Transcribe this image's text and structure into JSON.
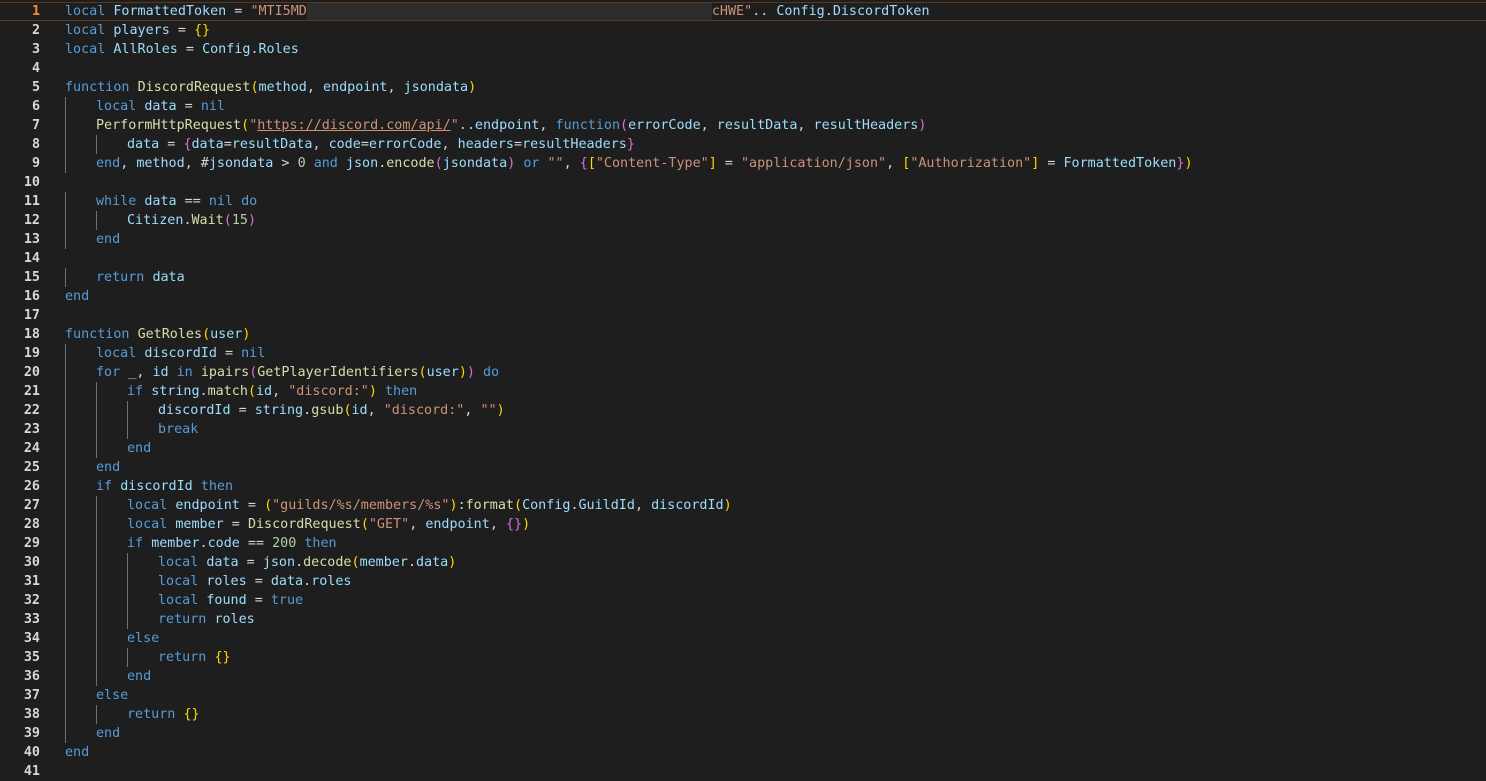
{
  "editor": {
    "active_line": 1,
    "lines": [
      {
        "n": "1",
        "indent": 0,
        "tokens": [
          [
            "kw",
            "local"
          ],
          [
            "op",
            " "
          ],
          [
            "var",
            "FormattedToken"
          ],
          [
            "op",
            " = "
          ],
          [
            "str",
            "\"MTI5MD"
          ],
          [
            "redact",
            "xxxxxxxxxxxxxxxxxxxxxxxxxxxxxxxxxxxxxxxxxxxxxxxxxxxxxxxxxxxx"
          ],
          [
            "str",
            "cHWE\""
          ],
          [
            "op",
            ".. "
          ],
          [
            "var",
            "Config"
          ],
          [
            "op",
            "."
          ],
          [
            "var",
            "DiscordToken"
          ]
        ]
      },
      {
        "n": "2",
        "indent": 0,
        "tokens": [
          [
            "kw",
            "local"
          ],
          [
            "op",
            " "
          ],
          [
            "var",
            "players"
          ],
          [
            "op",
            " = "
          ],
          [
            "brk",
            "{}"
          ]
        ]
      },
      {
        "n": "3",
        "indent": 0,
        "tokens": [
          [
            "kw",
            "local"
          ],
          [
            "op",
            " "
          ],
          [
            "var",
            "AllRoles"
          ],
          [
            "op",
            " = "
          ],
          [
            "var",
            "Config"
          ],
          [
            "op",
            "."
          ],
          [
            "var",
            "Roles"
          ]
        ]
      },
      {
        "n": "4",
        "indent": 0,
        "tokens": []
      },
      {
        "n": "5",
        "indent": 0,
        "tokens": [
          [
            "kw",
            "function"
          ],
          [
            "op",
            " "
          ],
          [
            "fn",
            "DiscordRequest"
          ],
          [
            "brk",
            "("
          ],
          [
            "var",
            "method"
          ],
          [
            "op",
            ", "
          ],
          [
            "var",
            "endpoint"
          ],
          [
            "op",
            ", "
          ],
          [
            "var",
            "jsondata"
          ],
          [
            "brk",
            ")"
          ]
        ]
      },
      {
        "n": "6",
        "indent": 1,
        "tokens": [
          [
            "kw",
            "local"
          ],
          [
            "op",
            " "
          ],
          [
            "var",
            "data"
          ],
          [
            "op",
            " = "
          ],
          [
            "kw",
            "nil"
          ]
        ]
      },
      {
        "n": "7",
        "indent": 1,
        "tokens": [
          [
            "fn",
            "PerformHttpRequest"
          ],
          [
            "brk",
            "("
          ],
          [
            "str",
            "\""
          ],
          [
            "url",
            "https://discord.com/api/"
          ],
          [
            "str",
            "\""
          ],
          [
            "op",
            ".."
          ],
          [
            "var",
            "endpoint"
          ],
          [
            "op",
            ", "
          ],
          [
            "kw",
            "function"
          ],
          [
            "brk2",
            "("
          ],
          [
            "var",
            "errorCode"
          ],
          [
            "op",
            ", "
          ],
          [
            "var",
            "resultData"
          ],
          [
            "op",
            ", "
          ],
          [
            "var",
            "resultHeaders"
          ],
          [
            "brk2",
            ")"
          ]
        ]
      },
      {
        "n": "8",
        "indent": 2,
        "tokens": [
          [
            "var",
            "data"
          ],
          [
            "op",
            " = "
          ],
          [
            "brk2",
            "{"
          ],
          [
            "var",
            "data"
          ],
          [
            "op",
            "="
          ],
          [
            "var",
            "resultData"
          ],
          [
            "op",
            ", "
          ],
          [
            "var",
            "code"
          ],
          [
            "op",
            "="
          ],
          [
            "var",
            "errorCode"
          ],
          [
            "op",
            ", "
          ],
          [
            "var",
            "headers"
          ],
          [
            "op",
            "="
          ],
          [
            "var",
            "resultHeaders"
          ],
          [
            "brk2",
            "}"
          ]
        ]
      },
      {
        "n": "9",
        "indent": 1,
        "tokens": [
          [
            "kw",
            "end"
          ],
          [
            "op",
            ", "
          ],
          [
            "var",
            "method"
          ],
          [
            "op",
            ", #"
          ],
          [
            "var",
            "jsondata"
          ],
          [
            "op",
            " > "
          ],
          [
            "num",
            "0"
          ],
          [
            "op",
            " "
          ],
          [
            "kw",
            "and"
          ],
          [
            "op",
            " "
          ],
          [
            "var",
            "json"
          ],
          [
            "op",
            "."
          ],
          [
            "fn",
            "encode"
          ],
          [
            "brk2",
            "("
          ],
          [
            "var",
            "jsondata"
          ],
          [
            "brk2",
            ")"
          ],
          [
            "op",
            " "
          ],
          [
            "kw",
            "or"
          ],
          [
            "op",
            " "
          ],
          [
            "str",
            "\"\""
          ],
          [
            "op",
            ", "
          ],
          [
            "brk2",
            "{"
          ],
          [
            "brk",
            "["
          ],
          [
            "str",
            "\"Content-Type\""
          ],
          [
            "brk",
            "]"
          ],
          [
            "op",
            " = "
          ],
          [
            "str",
            "\"application/json\""
          ],
          [
            "op",
            ", "
          ],
          [
            "brk",
            "["
          ],
          [
            "str",
            "\"Authorization\""
          ],
          [
            "brk",
            "]"
          ],
          [
            "op",
            " = "
          ],
          [
            "var",
            "FormattedToken"
          ],
          [
            "brk2",
            "}"
          ],
          [
            "brk",
            ")"
          ]
        ]
      },
      {
        "n": "10",
        "indent": 0,
        "tokens": []
      },
      {
        "n": "11",
        "indent": 1,
        "tokens": [
          [
            "kw",
            "while"
          ],
          [
            "op",
            " "
          ],
          [
            "var",
            "data"
          ],
          [
            "op",
            " == "
          ],
          [
            "kw",
            "nil"
          ],
          [
            "op",
            " "
          ],
          [
            "kw",
            "do"
          ]
        ]
      },
      {
        "n": "12",
        "indent": 2,
        "tokens": [
          [
            "var",
            "Citizen"
          ],
          [
            "op",
            "."
          ],
          [
            "fn",
            "Wait"
          ],
          [
            "brk2",
            "("
          ],
          [
            "num",
            "15"
          ],
          [
            "brk2",
            ")"
          ]
        ]
      },
      {
        "n": "13",
        "indent": 1,
        "tokens": [
          [
            "kw",
            "end"
          ]
        ]
      },
      {
        "n": "14",
        "indent": 0,
        "tokens": []
      },
      {
        "n": "15",
        "indent": 1,
        "tokens": [
          [
            "kw",
            "return"
          ],
          [
            "op",
            " "
          ],
          [
            "var",
            "data"
          ]
        ]
      },
      {
        "n": "16",
        "indent": 0,
        "tokens": [
          [
            "kw",
            "end"
          ]
        ]
      },
      {
        "n": "17",
        "indent": 0,
        "tokens": []
      },
      {
        "n": "18",
        "indent": 0,
        "tokens": [
          [
            "kw",
            "function"
          ],
          [
            "op",
            " "
          ],
          [
            "fn",
            "GetRoles"
          ],
          [
            "brk",
            "("
          ],
          [
            "var",
            "user"
          ],
          [
            "brk",
            ")"
          ]
        ]
      },
      {
        "n": "19",
        "indent": 1,
        "tokens": [
          [
            "kw",
            "local"
          ],
          [
            "op",
            " "
          ],
          [
            "var",
            "discordId"
          ],
          [
            "op",
            " = "
          ],
          [
            "kw",
            "nil"
          ]
        ]
      },
      {
        "n": "20",
        "indent": 1,
        "tokens": [
          [
            "kw",
            "for"
          ],
          [
            "op",
            " "
          ],
          [
            "var",
            "_"
          ],
          [
            "op",
            ", "
          ],
          [
            "var",
            "id"
          ],
          [
            "op",
            " "
          ],
          [
            "kw",
            "in"
          ],
          [
            "op",
            " "
          ],
          [
            "fn",
            "ipairs"
          ],
          [
            "brk2",
            "("
          ],
          [
            "fn",
            "GetPlayerIdentifiers"
          ],
          [
            "brk",
            "("
          ],
          [
            "var",
            "user"
          ],
          [
            "brk",
            ")"
          ],
          [
            "brk2",
            ")"
          ],
          [
            "op",
            " "
          ],
          [
            "kw",
            "do"
          ]
        ]
      },
      {
        "n": "21",
        "indent": 2,
        "tokens": [
          [
            "kw",
            "if"
          ],
          [
            "op",
            " "
          ],
          [
            "var",
            "string"
          ],
          [
            "op",
            "."
          ],
          [
            "fn",
            "match"
          ],
          [
            "brk",
            "("
          ],
          [
            "var",
            "id"
          ],
          [
            "op",
            ", "
          ],
          [
            "str",
            "\"discord:\""
          ],
          [
            "brk",
            ")"
          ],
          [
            "op",
            " "
          ],
          [
            "kw",
            "then"
          ]
        ]
      },
      {
        "n": "22",
        "indent": 3,
        "tokens": [
          [
            "var",
            "discordId"
          ],
          [
            "op",
            " = "
          ],
          [
            "var",
            "string"
          ],
          [
            "op",
            "."
          ],
          [
            "fn",
            "gsub"
          ],
          [
            "brk",
            "("
          ],
          [
            "var",
            "id"
          ],
          [
            "op",
            ", "
          ],
          [
            "str",
            "\"discord:\""
          ],
          [
            "op",
            ", "
          ],
          [
            "str",
            "\"\""
          ],
          [
            "brk",
            ")"
          ]
        ]
      },
      {
        "n": "23",
        "indent": 3,
        "tokens": [
          [
            "kw",
            "break"
          ]
        ]
      },
      {
        "n": "24",
        "indent": 2,
        "tokens": [
          [
            "kw",
            "end"
          ]
        ]
      },
      {
        "n": "25",
        "indent": 1,
        "tokens": [
          [
            "kw",
            "end"
          ]
        ]
      },
      {
        "n": "26",
        "indent": 1,
        "tokens": [
          [
            "kw",
            "if"
          ],
          [
            "op",
            " "
          ],
          [
            "var",
            "discordId"
          ],
          [
            "op",
            " "
          ],
          [
            "kw",
            "then"
          ]
        ]
      },
      {
        "n": "27",
        "indent": 2,
        "tokens": [
          [
            "kw",
            "local"
          ],
          [
            "op",
            " "
          ],
          [
            "var",
            "endpoint"
          ],
          [
            "op",
            " = "
          ],
          [
            "brk",
            "("
          ],
          [
            "str",
            "\"guilds/%s/members/%s\""
          ],
          [
            "brk",
            ")"
          ],
          [
            "op",
            ":"
          ],
          [
            "fn",
            "format"
          ],
          [
            "brk",
            "("
          ],
          [
            "var",
            "Config"
          ],
          [
            "op",
            "."
          ],
          [
            "var",
            "GuildId"
          ],
          [
            "op",
            ", "
          ],
          [
            "var",
            "discordId"
          ],
          [
            "brk",
            ")"
          ]
        ]
      },
      {
        "n": "28",
        "indent": 2,
        "tokens": [
          [
            "kw",
            "local"
          ],
          [
            "op",
            " "
          ],
          [
            "var",
            "member"
          ],
          [
            "op",
            " = "
          ],
          [
            "fn",
            "DiscordRequest"
          ],
          [
            "brk",
            "("
          ],
          [
            "str",
            "\"GET\""
          ],
          [
            "op",
            ", "
          ],
          [
            "var",
            "endpoint"
          ],
          [
            "op",
            ", "
          ],
          [
            "brk2",
            "{}"
          ],
          [
            "brk",
            ")"
          ]
        ]
      },
      {
        "n": "29",
        "indent": 2,
        "tokens": [
          [
            "kw",
            "if"
          ],
          [
            "op",
            " "
          ],
          [
            "var",
            "member"
          ],
          [
            "op",
            "."
          ],
          [
            "var",
            "code"
          ],
          [
            "op",
            " == "
          ],
          [
            "num",
            "200"
          ],
          [
            "op",
            " "
          ],
          [
            "kw",
            "then"
          ]
        ]
      },
      {
        "n": "30",
        "indent": 3,
        "tokens": [
          [
            "kw",
            "local"
          ],
          [
            "op",
            " "
          ],
          [
            "var",
            "data"
          ],
          [
            "op",
            " = "
          ],
          [
            "var",
            "json"
          ],
          [
            "op",
            "."
          ],
          [
            "fn",
            "decode"
          ],
          [
            "brk",
            "("
          ],
          [
            "var",
            "member"
          ],
          [
            "op",
            "."
          ],
          [
            "var",
            "data"
          ],
          [
            "brk",
            ")"
          ]
        ]
      },
      {
        "n": "31",
        "indent": 3,
        "tokens": [
          [
            "kw",
            "local"
          ],
          [
            "op",
            " "
          ],
          [
            "var",
            "roles"
          ],
          [
            "op",
            " = "
          ],
          [
            "var",
            "data"
          ],
          [
            "op",
            "."
          ],
          [
            "var",
            "roles"
          ]
        ]
      },
      {
        "n": "32",
        "indent": 3,
        "tokens": [
          [
            "kw",
            "local"
          ],
          [
            "op",
            " "
          ],
          [
            "var",
            "found"
          ],
          [
            "op",
            " = "
          ],
          [
            "kw",
            "true"
          ]
        ]
      },
      {
        "n": "33",
        "indent": 3,
        "tokens": [
          [
            "kw",
            "return"
          ],
          [
            "op",
            " "
          ],
          [
            "var",
            "roles"
          ]
        ]
      },
      {
        "n": "34",
        "indent": 2,
        "tokens": [
          [
            "kw",
            "else"
          ]
        ]
      },
      {
        "n": "35",
        "indent": 3,
        "tokens": [
          [
            "kw",
            "return"
          ],
          [
            "op",
            " "
          ],
          [
            "brk",
            "{}"
          ]
        ]
      },
      {
        "n": "36",
        "indent": 2,
        "tokens": [
          [
            "kw",
            "end"
          ]
        ]
      },
      {
        "n": "37",
        "indent": 1,
        "tokens": [
          [
            "kw",
            "else"
          ]
        ]
      },
      {
        "n": "38",
        "indent": 2,
        "tokens": [
          [
            "kw",
            "return"
          ],
          [
            "op",
            " "
          ],
          [
            "brk",
            "{}"
          ]
        ]
      },
      {
        "n": "39",
        "indent": 1,
        "tokens": [
          [
            "kw",
            "end"
          ]
        ]
      },
      {
        "n": "40",
        "indent": 0,
        "tokens": [
          [
            "kw",
            "end"
          ]
        ]
      },
      {
        "n": "41",
        "indent": 0,
        "tokens": []
      }
    ]
  }
}
